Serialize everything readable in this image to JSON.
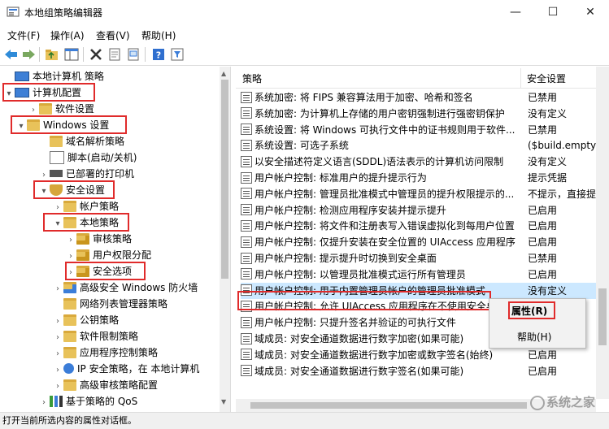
{
  "window": {
    "title": "本地组策略编辑器",
    "minimize": "—",
    "maximize": "☐",
    "close": "✕"
  },
  "menu": [
    "文件(F)",
    "操作(A)",
    "查看(V)",
    "帮助(H)"
  ],
  "toolbar": [
    "back-icon",
    "forward-icon",
    "up-folder-icon",
    "show-hide-tree-icon",
    "delete-icon",
    "properties-icon",
    "export-icon",
    "help-icon",
    "filter-icon"
  ],
  "tree": [
    {
      "label": "本地计算机 策略",
      "arrow": ""
    },
    {
      "label": "计算机配置",
      "arrow": "▾"
    },
    {
      "label": "软件设置",
      "arrow": "›"
    },
    {
      "label": "Windows 设置",
      "arrow": "▾"
    },
    {
      "label": "域名解析策略",
      "arrow": ""
    },
    {
      "label": "脚本(启动/关机)",
      "arrow": ""
    },
    {
      "label": "已部署的打印机",
      "arrow": "›"
    },
    {
      "label": "安全设置",
      "arrow": "▾"
    },
    {
      "label": "帐户策略",
      "arrow": "›"
    },
    {
      "label": "本地策略",
      "arrow": "▾"
    },
    {
      "label": "审核策略",
      "arrow": "›"
    },
    {
      "label": "用户权限分配",
      "arrow": "›"
    },
    {
      "label": "安全选项",
      "arrow": "›"
    },
    {
      "label": "高级安全 Windows 防火墙",
      "arrow": "›"
    },
    {
      "label": "网络列表管理器策略",
      "arrow": ""
    },
    {
      "label": "公钥策略",
      "arrow": "›"
    },
    {
      "label": "软件限制策略",
      "arrow": "›"
    },
    {
      "label": "应用程序控制策略",
      "arrow": "›"
    },
    {
      "label": "IP 安全策略，在 本地计算机",
      "arrow": "›"
    },
    {
      "label": "高级审核策略配置",
      "arrow": "›"
    },
    {
      "label": "基于策略的 QoS",
      "arrow": "›"
    }
  ],
  "columns": {
    "policy": "策略",
    "setting": "安全设置"
  },
  "policies": [
    {
      "name": "系统加密: 将 FIPS 兼容算法用于加密、哈希和签名",
      "value": "已禁用"
    },
    {
      "name": "系统加密: 为计算机上存储的用户密钥强制进行强密钥保护",
      "value": "没有定义"
    },
    {
      "name": "系统设置: 将 Windows 可执行文件中的证书规则用于软件...",
      "value": "已禁用"
    },
    {
      "name": "系统设置: 可选子系统",
      "value": "($build.empty)"
    },
    {
      "name": "以安全描述符定义语言(SDDL)语法表示的计算机访问限制",
      "value": "没有定义"
    },
    {
      "name": "用户帐户控制: 标准用户的提升提示行为",
      "value": "提示凭据"
    },
    {
      "name": "用户帐户控制: 管理员批准模式中管理员的提升权限提示的...",
      "value": "不提示，直接提"
    },
    {
      "name": "用户帐户控制: 检测应用程序安装并提示提升",
      "value": "已启用"
    },
    {
      "name": "用户帐户控制: 将文件和注册表写入错误虚拟化到每用户位置",
      "value": "已启用"
    },
    {
      "name": "用户帐户控制: 仅提升安装在安全位置的 UIAccess 应用程序",
      "value": "已启用"
    },
    {
      "name": "用户帐户控制: 提示提升时切换到安全桌面",
      "value": "已禁用"
    },
    {
      "name": "用户帐户控制: 以管理员批准模式运行所有管理员",
      "value": "已启用"
    },
    {
      "name": "用户帐户控制: 用于内置管理员帐户的管理员批准模式",
      "value": "没有定义"
    },
    {
      "name": "用户帐户控制: 允许 UIAccess 应用程序在不使用安全桌...",
      "value": ""
    },
    {
      "name": "用户帐户控制: 只提升签名并验证的可执行文件",
      "value": ""
    },
    {
      "name": "域成员: 对安全通道数据进行数字加密(如果可能)",
      "value": "已启用"
    },
    {
      "name": "域成员: 对安全通道数据进行数字加密或数字签名(始终)",
      "value": "已启用"
    },
    {
      "name": "域成员: 对安全通道数据进行数字签名(如果可能)",
      "value": "已启用"
    }
  ],
  "context_menu": {
    "properties": "属性(R)",
    "help": "帮助(H)"
  },
  "status": "打开当前所选内容的属性对话框。",
  "watermark": "系统之家",
  "colors": {
    "selection": "#cce8ff",
    "highlight_box": "#e02b2b",
    "folder": "#e8c25a"
  }
}
